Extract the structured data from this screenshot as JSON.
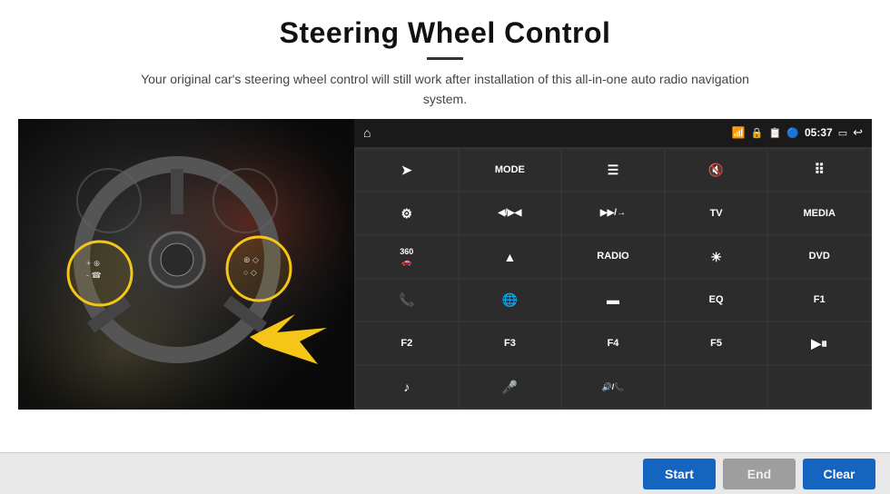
{
  "header": {
    "title": "Steering Wheel Control",
    "subtitle": "Your original car's steering wheel control will still work after installation of this all-in-one auto radio navigation system."
  },
  "status_bar": {
    "time": "05:37",
    "wifi_icon": "wifi",
    "lock_icon": "lock",
    "signal_icon": "signal",
    "bluetooth_icon": "bluetooth",
    "home_icon": "home",
    "back_icon": "back",
    "apps_icon": "apps"
  },
  "button_grid": [
    {
      "id": "nav",
      "label": "➤",
      "type": "icon"
    },
    {
      "id": "mode",
      "label": "MODE",
      "type": "text"
    },
    {
      "id": "menu",
      "label": "≡",
      "type": "icon"
    },
    {
      "id": "mute",
      "label": "🔇",
      "type": "icon"
    },
    {
      "id": "apps-grid",
      "label": "⠿",
      "type": "icon"
    },
    {
      "id": "settings-gear",
      "label": "⚙",
      "type": "icon"
    },
    {
      "id": "prev",
      "label": "◀/▶◀",
      "type": "icon"
    },
    {
      "id": "next",
      "label": "▶▶/→",
      "type": "icon"
    },
    {
      "id": "tv",
      "label": "TV",
      "type": "text"
    },
    {
      "id": "media",
      "label": "MEDIA",
      "type": "text"
    },
    {
      "id": "cam360",
      "label": "360",
      "type": "text"
    },
    {
      "id": "eject",
      "label": "▲",
      "type": "icon"
    },
    {
      "id": "radio",
      "label": "RADIO",
      "type": "text"
    },
    {
      "id": "brightness",
      "label": "☀",
      "type": "icon"
    },
    {
      "id": "dvd",
      "label": "DVD",
      "type": "text"
    },
    {
      "id": "phone",
      "label": "📞",
      "type": "icon"
    },
    {
      "id": "internet",
      "label": "🌐",
      "type": "icon"
    },
    {
      "id": "mirror",
      "label": "▭",
      "type": "icon"
    },
    {
      "id": "eq",
      "label": "EQ",
      "type": "text"
    },
    {
      "id": "f1",
      "label": "F1",
      "type": "text"
    },
    {
      "id": "f2",
      "label": "F2",
      "type": "text"
    },
    {
      "id": "f3",
      "label": "F3",
      "type": "text"
    },
    {
      "id": "f4",
      "label": "F4",
      "type": "text"
    },
    {
      "id": "f5",
      "label": "F5",
      "type": "text"
    },
    {
      "id": "playpause",
      "label": "▶⏸",
      "type": "icon"
    },
    {
      "id": "music",
      "label": "♪",
      "type": "icon"
    },
    {
      "id": "mic",
      "label": "🎤",
      "type": "icon"
    },
    {
      "id": "vol-call",
      "label": "🔊/📞",
      "type": "icon"
    },
    {
      "id": "empty1",
      "label": "",
      "type": "empty"
    },
    {
      "id": "empty2",
      "label": "",
      "type": "empty"
    }
  ],
  "action_buttons": {
    "start": "Start",
    "end": "End",
    "clear": "Clear"
  }
}
